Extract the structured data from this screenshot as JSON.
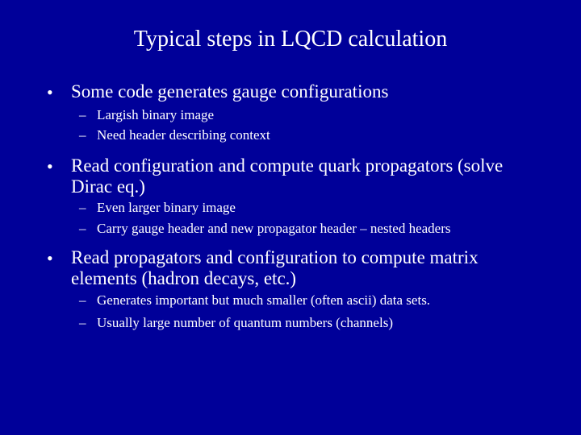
{
  "slide": {
    "title": "Typical steps in LQCD calculation",
    "background_color": "#000099",
    "text_color": "#ffffff",
    "bullet_glyph": "•",
    "dash_glyph": "–",
    "items": [
      {
        "text": "Some code generates gauge configurations",
        "subitems": [
          "Largish binary image",
          "Need header describing context"
        ]
      },
      {
        "text": "Read configuration and compute quark propagators (solve Dirac eq.)",
        "subitems": [
          "Even larger binary image",
          "Carry gauge header and new propagator header – nested headers"
        ]
      },
      {
        "text": "Read propagators and configuration to compute matrix elements (hadron decays, etc.)",
        "subitems": [
          "Generates important but much smaller (often ascii) data sets.",
          "Usually large number of quantum numbers (channels)"
        ]
      }
    ]
  }
}
